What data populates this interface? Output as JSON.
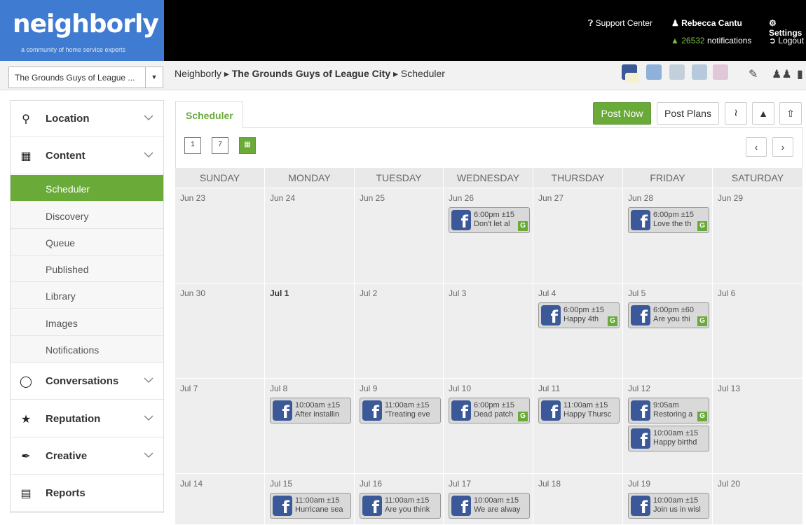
{
  "brand": {
    "name": "neighborly",
    "tagline": "a community of home service experts",
    "accent": "#3f7bd1",
    "green": "#6aaa39"
  },
  "topnav": {
    "support": "Support Center",
    "user": "Rebecca Cantu",
    "notif_count": "26532",
    "notif_label": "notifications",
    "settings": "Settings",
    "logout": "Logout"
  },
  "location_select": {
    "value": "The Grounds Guys of League ..."
  },
  "breadcrumb": {
    "root": "Neighborly",
    "business": "The Grounds Guys of League City",
    "page": "Scheduler"
  },
  "sidebar": {
    "sections": [
      {
        "label": "Location",
        "icon": "map-pin-icon"
      },
      {
        "label": "Content",
        "icon": "calendar-icon"
      },
      {
        "label": "Conversations",
        "icon": "chat-icon"
      },
      {
        "label": "Reputation",
        "icon": "star-icon"
      },
      {
        "label": "Creative",
        "icon": "brush-icon"
      },
      {
        "label": "Reports",
        "icon": "document-icon"
      }
    ],
    "content_items": [
      "Scheduler",
      "Discovery",
      "Queue",
      "Published",
      "Library",
      "Images",
      "Notifications"
    ]
  },
  "tab": {
    "label": "Scheduler"
  },
  "actions": {
    "post_now": "Post Now",
    "post_plans": "Post Plans"
  },
  "view_buttons": {
    "day": "1",
    "week": "7"
  },
  "calendar": {
    "days": [
      "SUNDAY",
      "MONDAY",
      "TUESDAY",
      "WEDNESDAY",
      "THURSDAY",
      "FRIDAY",
      "SATURDAY"
    ],
    "weeks": [
      [
        "Jun 23",
        "Jun 24",
        "Jun 25",
        "Jun 26",
        "Jun 27",
        "Jun 28",
        "Jun 29"
      ],
      [
        "Jun 30",
        "Jul 1",
        "Jul 2",
        "Jul 3",
        "Jul 4",
        "Jul 5",
        "Jul 6"
      ],
      [
        "Jul 7",
        "Jul 8",
        "Jul 9",
        "Jul 10",
        "Jul 11",
        "Jul 12",
        "Jul 13"
      ],
      [
        "Jul 14",
        "Jul 15",
        "Jul 16",
        "Jul 17",
        "Jul 18",
        "Jul 19",
        "Jul 20"
      ]
    ],
    "today": "Jul 1",
    "posts": [
      {
        "week": 0,
        "day": 3,
        "slot": 0,
        "time": "6:00pm ±15",
        "text": "Don't let al",
        "g": true
      },
      {
        "week": 0,
        "day": 5,
        "slot": 0,
        "time": "6:00pm ±15",
        "text": "Love the th",
        "g": true
      },
      {
        "week": 1,
        "day": 4,
        "slot": 0,
        "time": "6:00pm ±15",
        "text": "Happy 4th",
        "g": true
      },
      {
        "week": 1,
        "day": 5,
        "slot": 0,
        "time": "6:00pm ±60",
        "text": "Are you thi",
        "g": true
      },
      {
        "week": 2,
        "day": 1,
        "slot": 0,
        "time": "10:00am ±15",
        "text": "After installin",
        "g": false
      },
      {
        "week": 2,
        "day": 2,
        "slot": 0,
        "time": "11:00am ±15",
        "text": "\"Treating eve",
        "g": false
      },
      {
        "week": 2,
        "day": 3,
        "slot": 0,
        "time": "6:00pm ±15",
        "text": "Dead patch",
        "g": true
      },
      {
        "week": 2,
        "day": 4,
        "slot": 0,
        "time": "11:00am ±15",
        "text": "Happy Thursc",
        "g": false
      },
      {
        "week": 2,
        "day": 5,
        "slot": 0,
        "time": "9:05am",
        "text": "Restoring a",
        "g": true
      },
      {
        "week": 2,
        "day": 5,
        "slot": 1,
        "time": "10:00am ±15",
        "text": "Happy birthd",
        "g": false
      },
      {
        "week": 3,
        "day": 1,
        "slot": 0,
        "time": "11:00am ±15",
        "text": "Hurricane sea",
        "g": false
      },
      {
        "week": 3,
        "day": 2,
        "slot": 0,
        "time": "11:00am ±15",
        "text": "Are you think",
        "g": false
      },
      {
        "week": 3,
        "day": 3,
        "slot": 0,
        "time": "10:00am ±15",
        "text": "We are alway",
        "g": false
      },
      {
        "week": 3,
        "day": 5,
        "slot": 0,
        "time": "10:00am ±15",
        "text": "Join us in wisl",
        "g": false
      }
    ]
  }
}
